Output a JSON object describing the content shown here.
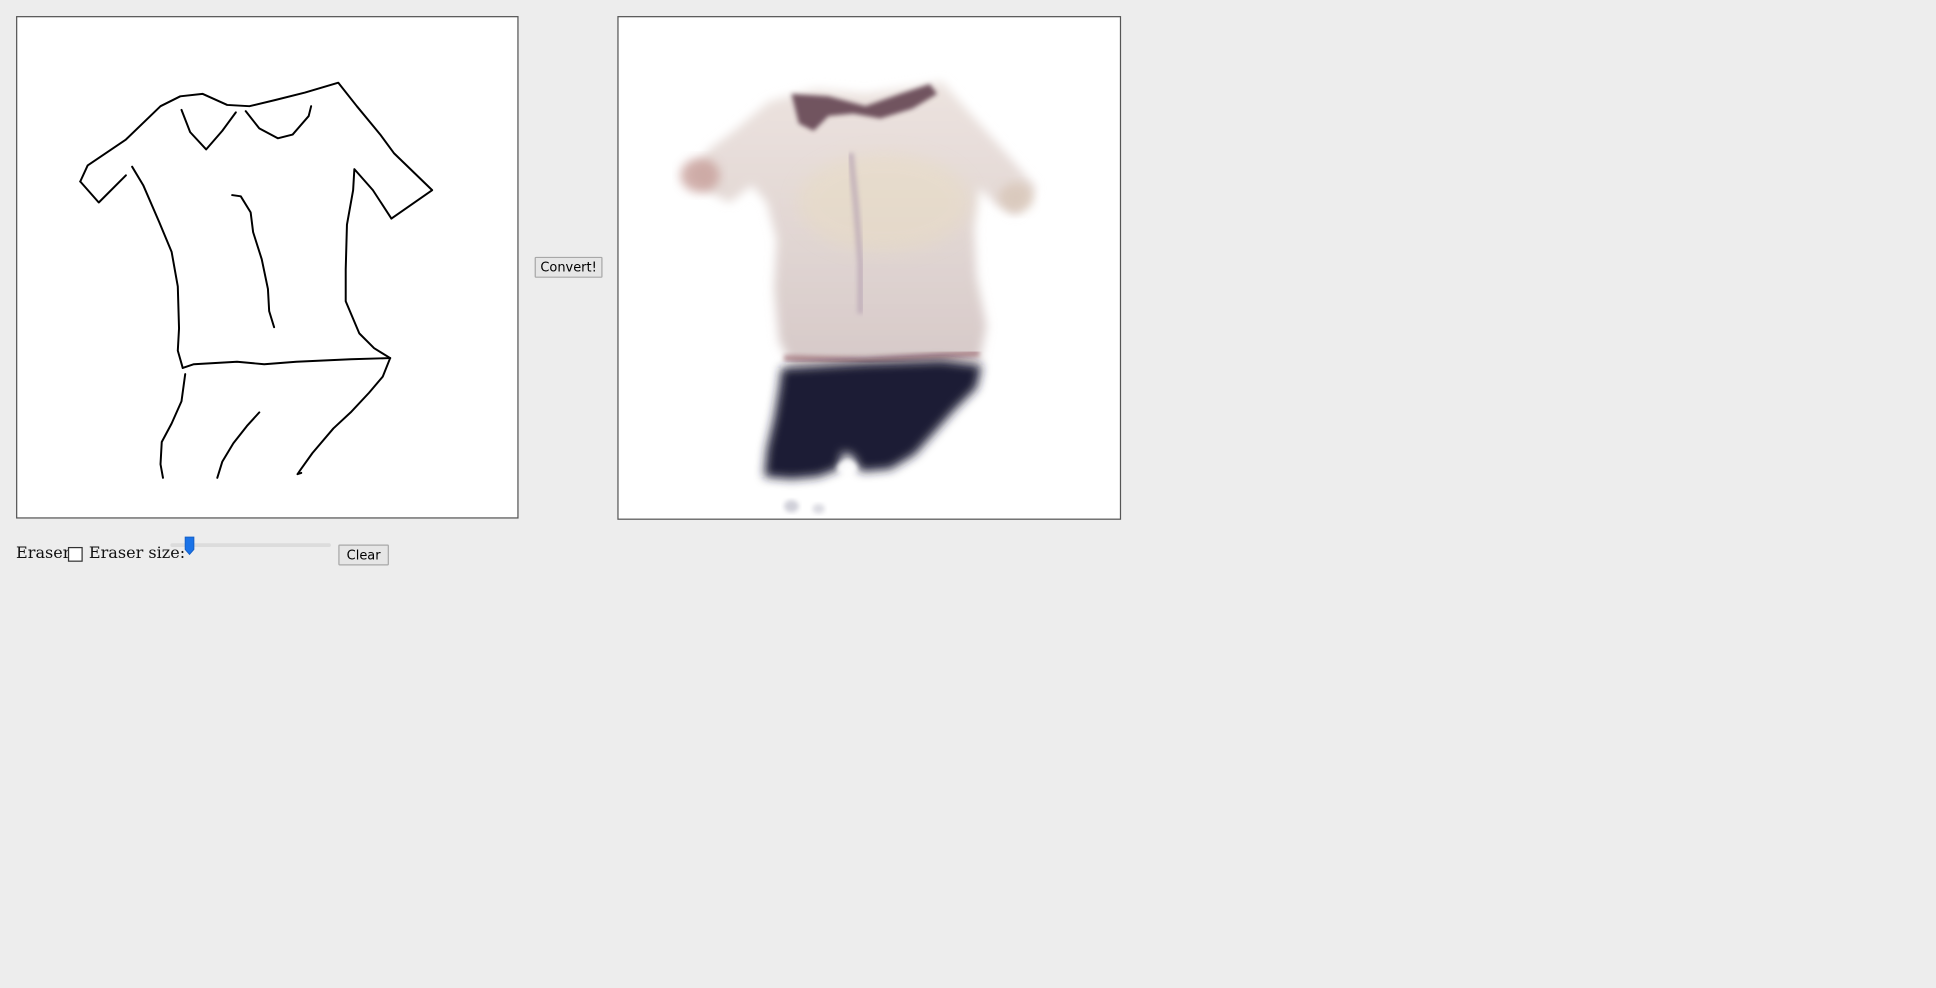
{
  "controls": {
    "convert_label": "Convert!",
    "clear_label": "Clear",
    "eraser_label": "Eraser:",
    "eraser_size_label": "Eraser size:",
    "eraser_checked": false,
    "eraser_size_fraction": 0.12
  },
  "colors": {
    "page_background": "#ededed",
    "accent": "#1a73e8",
    "sketch_stroke": "#000000",
    "shirt": "#e0d4d2",
    "pants": "#1a1c36"
  },
  "canvases": {
    "sketch": "sketch-canvas",
    "output": "output-canvas"
  }
}
